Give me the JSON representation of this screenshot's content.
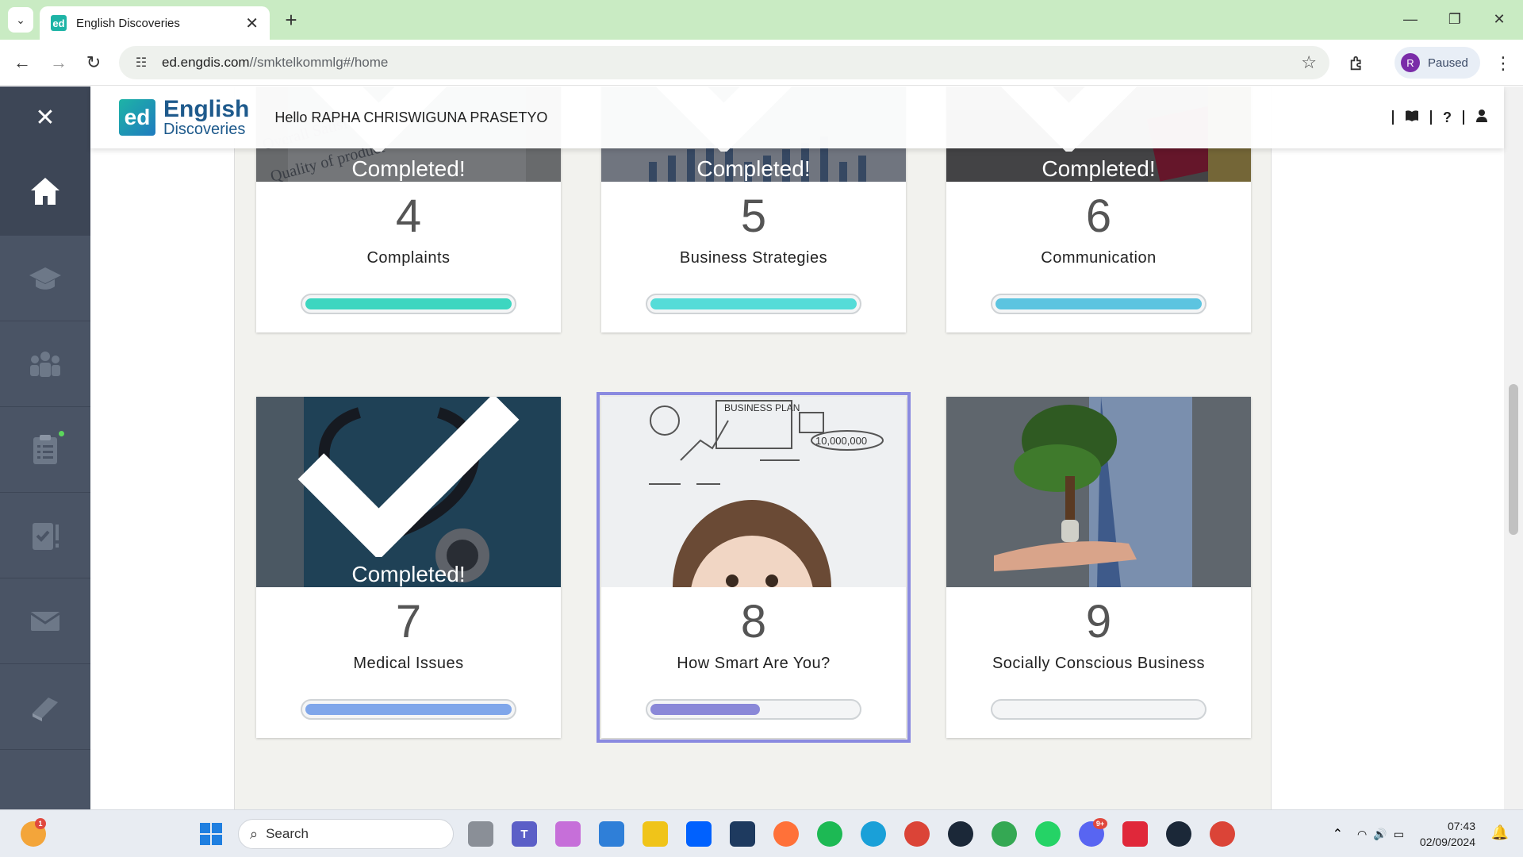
{
  "browser": {
    "tab_title": "English Discoveries",
    "tab_favicon": "ed",
    "url_host": "ed.engdis.com",
    "url_path": "//smktelkommlg#/home",
    "profile_initial": "R",
    "profile_status": "Paused"
  },
  "app": {
    "logo_mark": "ed",
    "logo_line1": "English",
    "logo_line2": "Discoveries",
    "greeting": "Hello RAPHA CHRISWIGUNA PRASETYO"
  },
  "sidebar": {
    "items": [
      {
        "icon": "home-icon",
        "active": true
      },
      {
        "icon": "graduation-cap-icon"
      },
      {
        "icon": "community-icon"
      },
      {
        "icon": "clipboard-list-icon",
        "notification": true
      },
      {
        "icon": "tests-icon"
      },
      {
        "icon": "envelope-icon"
      },
      {
        "icon": "book-icon"
      }
    ]
  },
  "units": [
    {
      "number": "4",
      "title": "Complaints",
      "completed": true,
      "status": "Completed!",
      "progress": 1.0,
      "color": "#3dd6c0"
    },
    {
      "number": "5",
      "title": "Business Strategies",
      "completed": true,
      "status": "Completed!",
      "progress": 1.0,
      "color": "#55dcd8"
    },
    {
      "number": "6",
      "title": "Communication",
      "completed": true,
      "status": "Completed!",
      "progress": 1.0,
      "color": "#5cc4e0"
    },
    {
      "number": "7",
      "title": "Medical Issues",
      "completed": true,
      "status": "Completed!",
      "progress": 1.0,
      "color": "#7fa6ea"
    },
    {
      "number": "8",
      "title": "How Smart Are You?",
      "completed": false,
      "status": "",
      "progress": 0.53,
      "color": "#8a88d8"
    },
    {
      "number": "9",
      "title": "Socially Conscious Business",
      "completed": false,
      "status": "",
      "progress": 0.0,
      "color": "#c9c9c9"
    }
  ],
  "taskbar": {
    "search_label": "Search",
    "time": "07:43",
    "date": "02/09/2024",
    "weather_badge": "1",
    "discord_badge": "9+"
  }
}
